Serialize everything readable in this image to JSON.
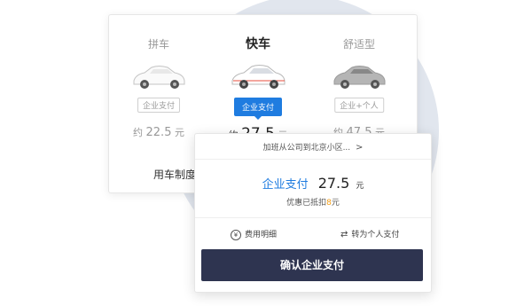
{
  "car_types": [
    {
      "name": "拼车",
      "badge": "企业支付",
      "est_prefix": "约",
      "est_value": "22.5",
      "est_unit": "元",
      "active": false
    },
    {
      "name": "快车",
      "badge": "企业支付",
      "est_prefix": "约",
      "est_value": "27.5",
      "est_unit": "元",
      "active": true
    },
    {
      "name": "舒适型",
      "badge": "企业+个人",
      "est_prefix": "约",
      "est_value": "47.5",
      "est_unit": "元",
      "active": false
    }
  ],
  "car_rules_label": "用车制度",
  "payment": {
    "route": "加班从公司到北京小区...",
    "route_chevron": ">",
    "pay_label": "企业支付",
    "amount": "27.5",
    "unit": "元",
    "discount_prefix": "优惠已抵扣",
    "discount_value": "8",
    "discount_unit": "元",
    "fee_detail_icon": "¥",
    "fee_detail": "费用明细",
    "switch_icon": "⇄",
    "switch_personal": "转为个人支付",
    "confirm_button": "确认企业支付"
  },
  "colors": {
    "accent": "#1f7ce0",
    "button": "#2e3450",
    "discount": "#f39c12",
    "circle": "#e1e6ee"
  }
}
